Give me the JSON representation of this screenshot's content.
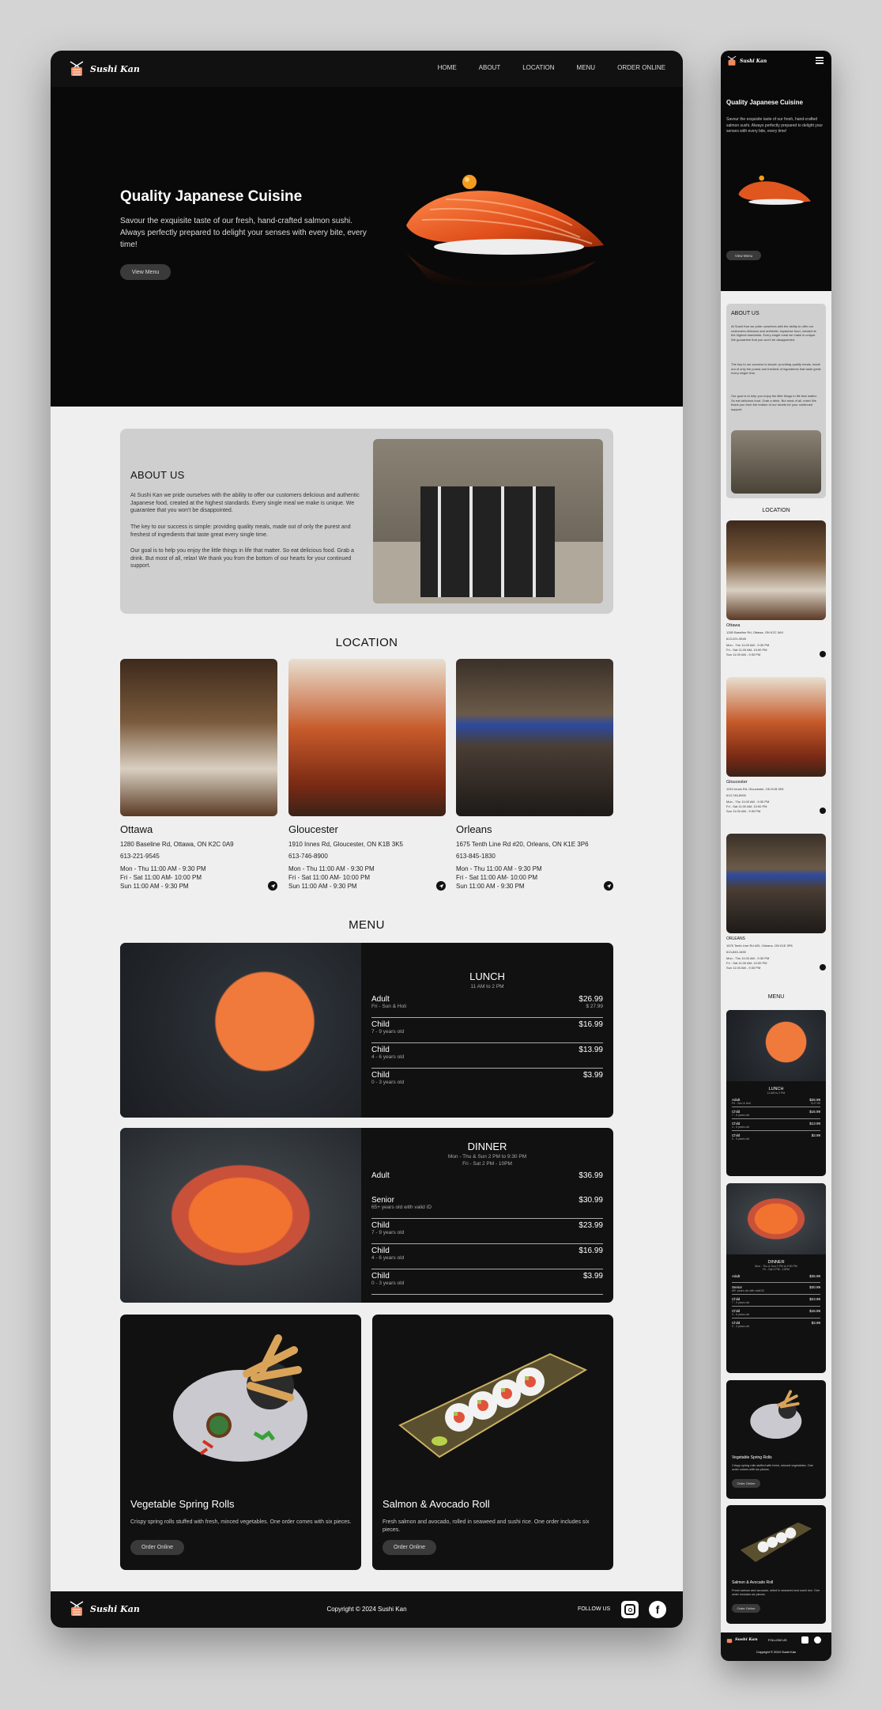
{
  "brand": {
    "name": "Sushi Kan"
  },
  "nav": {
    "items": [
      "HOME",
      "ABOUT",
      "LOCATION",
      "MENU",
      "ORDER ONLINE"
    ]
  },
  "hero": {
    "title": "Quality Japanese Cuisine",
    "text": "Savour the exquisite taste of our fresh, hand-crafted salmon sushi. Always perfectly prepared to delight your senses with every bite, every time!",
    "button": "View Menu"
  },
  "about": {
    "title": "ABOUT US",
    "p1": "At Sushi Kan we pride ourselves with the ability to offer our customers delicious and authentic Japanese food, created at the highest standards. Every single meal we make is unique. We guarantee that you won't be disappointed.",
    "p2": "The key to our success is simple: providing quality meals, made out of only the purest and freshest of ingredients that taste great every single time.",
    "p3": "Our goal is to help you enjoy the little things in life that matter. So eat delicious food. Grab a drink. But most of all, relax! We thank you from the bottom of our hearts for your continued support."
  },
  "location": {
    "title": "LOCATION",
    "items": [
      {
        "name": "Ottawa",
        "address": "1280 Baseline Rd, Ottawa, ON K2C 0A9",
        "phone": "613-221-9545",
        "h1": "Mon - Thu 11:00 AM - 9:30 PM",
        "h2": "Fri - Sat 11:00 AM- 10:00 PM",
        "h3": "Sun 11:00 AM - 9:30 PM"
      },
      {
        "name": "Gloucester",
        "address": "1910 Innes Rd, Gloucester, ON K1B 3K5",
        "phone": "613-746-8900",
        "h1": "Mon - Thu 11:00 AM - 9:30 PM",
        "h2": "Fri - Sat 11:00 AM- 10:00 PM",
        "h3": "Sun 11:00 AM - 9:30 PM"
      },
      {
        "name": "Orleans",
        "address": "1675 Tenth Line Rd #20, Orleans, ON K1E 3P6",
        "phone": "613-845-1830",
        "h1": "Mon - Thu 11:00 AM - 9:30 PM",
        "h2": "Fri - Sat 11:00 AM- 10:00 PM",
        "h3": "Sun 11:00 AM - 9:30 PM"
      }
    ],
    "mobile_orleans_name": "ORLEANS"
  },
  "menu": {
    "title": "MENU",
    "lunch": {
      "title": "LUNCH",
      "time": "11 AM to 2 PM",
      "rows": [
        {
          "label": "Adult",
          "sub": "Fri - Sun & Holi",
          "price": "$26.99",
          "price2": "$ 27.99"
        },
        {
          "label": "Child",
          "sub": "7 - 9 years old",
          "price": "$16.99"
        },
        {
          "label": "Child",
          "sub": "4 - 6 years old",
          "price": "$13.99"
        },
        {
          "label": "Child",
          "sub": "0 - 3 years old",
          "price": "$3.99"
        }
      ]
    },
    "dinner": {
      "title": "DINNER",
      "time1": "Mon - Thu & Sun 2 PM to 9:30 PM",
      "time2": "Fri - Sat 2 PM - 10PM",
      "rows": [
        {
          "label": "Adult",
          "sub": "",
          "price": "$36.99"
        },
        {
          "label": "Senior",
          "sub": "65+ years old with valid ID",
          "price": "$30.99"
        },
        {
          "label": "Child",
          "sub": "7 - 9 years old",
          "price": "$23.99"
        },
        {
          "label": "Child",
          "sub": "4 - 6 years old",
          "price": "$16.99"
        },
        {
          "label": "Child",
          "sub": "0 - 3 years old",
          "price": "$3.99"
        }
      ]
    },
    "spring": {
      "title": "Vegetable Spring Rolls",
      "text": "Crispy spring rolls stuffed with fresh, minced vegetables. One order comes with six pieces.",
      "button": "Order Online"
    },
    "salmon": {
      "title": "Salmon & Avocado Roll",
      "text": "Fresh salmon and avocado, rolled in seaweed and sushi rice. One order includes six pieces.",
      "button": "Order Online"
    }
  },
  "footer": {
    "copyright": "Copyright © 2024 Sushi Kan",
    "follow": "FOLLOW US"
  }
}
